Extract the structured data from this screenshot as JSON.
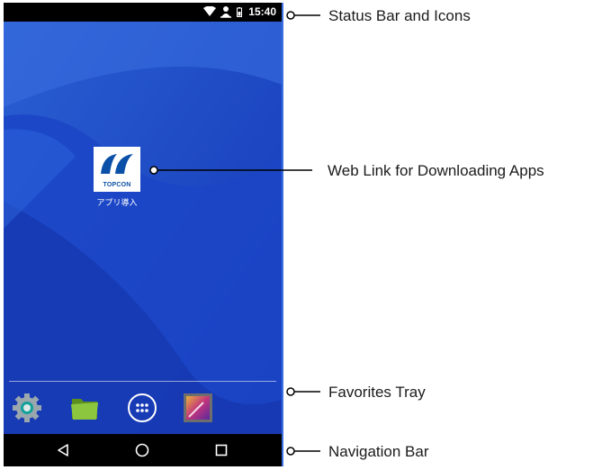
{
  "status_bar": {
    "time": "15:40"
  },
  "home": {
    "app_shortcut": {
      "brand": "TOPCON",
      "label": "アプリ導入"
    }
  },
  "callouts": [
    {
      "label": "Status Bar and Icons"
    },
    {
      "label": "Web Link for Downloading Apps"
    },
    {
      "label": "Favorites Tray"
    },
    {
      "label": "Navigation Bar"
    }
  ],
  "icons": {
    "status": [
      "wifi-icon",
      "person-icon",
      "battery-icon"
    ],
    "tray": [
      "settings-icon",
      "folder-icon",
      "app-drawer-icon",
      "gallery-icon"
    ],
    "nav": [
      "back-icon",
      "home-icon",
      "recents-icon"
    ]
  },
  "colors": {
    "wallpaper": "#1a4fc4",
    "bars": "#000000",
    "callout_line": "#000000"
  }
}
